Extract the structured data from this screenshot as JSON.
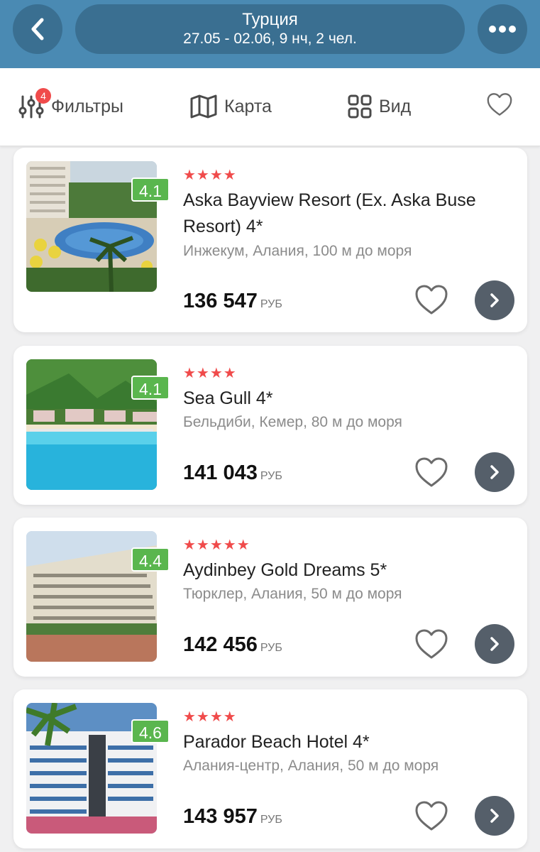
{
  "header": {
    "title": "Турция",
    "subtitle": "27.05 - 02.06, 9 нч, 2 чел."
  },
  "icons": {
    "back": "chevron-left-icon",
    "more": "more-dots-icon",
    "filters": "sliders-icon",
    "map": "map-icon",
    "view": "grid-icon",
    "favorites": "heart-icon",
    "open": "chevron-right-icon"
  },
  "toolbar": {
    "filters_label": "Фильтры",
    "filters_badge": "4",
    "map_label": "Карта",
    "view_label": "Вид"
  },
  "colors": {
    "header": "#4a8ab3",
    "header_button": "#3a6f91",
    "stars": "#f04b4b",
    "rating": "#5ab64e",
    "go_button": "#555f6a"
  },
  "hotels": [
    {
      "stars": "★★★★",
      "rating": "4.1",
      "name": "Aska Bayview Resort (Ex. Aska Buse Resort) 4*",
      "location": "Инжекум, Алания, 100 м до моря",
      "price": "136 547",
      "currency": "РУБ"
    },
    {
      "stars": "★★★★",
      "rating": "4.1",
      "name": "Sea Gull 4*",
      "location": "Бельдиби, Кемер, 80 м до моря",
      "price": "141 043",
      "currency": "РУБ"
    },
    {
      "stars": "★★★★★",
      "rating": "4.4",
      "name": "Aydinbey Gold Dreams 5*",
      "location": "Тюрклер, Алания, 50 м до моря",
      "price": "142 456",
      "currency": "РУБ"
    },
    {
      "stars": "★★★★",
      "rating": "4.6",
      "name": "Parador Beach Hotel 4*",
      "location": "Алания-центр, Алания, 50 м до моря",
      "price": "143 957",
      "currency": "РУБ"
    }
  ]
}
